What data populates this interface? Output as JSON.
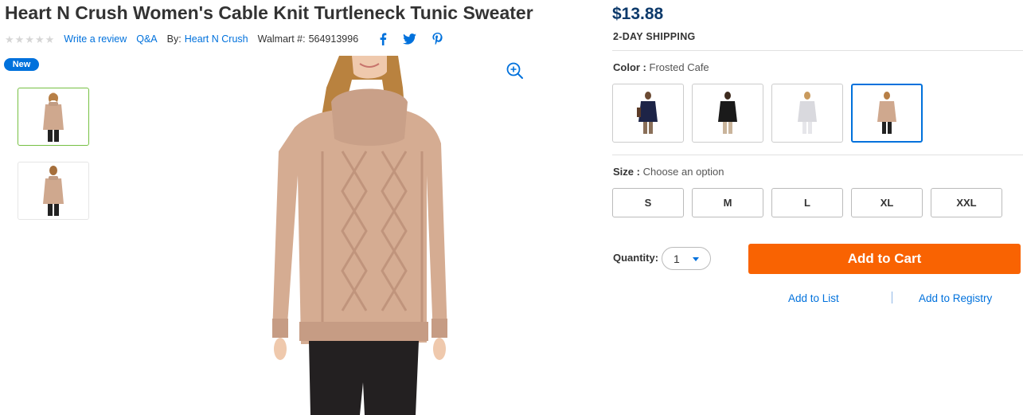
{
  "product": {
    "title": "Heart N Crush Women's Cable Knit Turtleneck Tunic Sweater",
    "rating_stars": 0,
    "write_review": "Write a review",
    "qa": "Q&A",
    "by_label": "By:",
    "brand": "Heart N Crush",
    "walmart_label": "Walmart #:",
    "walmart_number": "564913996",
    "badge": "New"
  },
  "social": {
    "facebook_icon": "facebook-icon",
    "twitter_icon": "twitter-icon",
    "pinterest_icon": "pinterest-icon"
  },
  "pricing": {
    "price": "$13.88",
    "shipping": "2-DAY SHIPPING"
  },
  "color": {
    "label": "Color :",
    "value": "Frosted Cafe",
    "options": [
      "navy",
      "black",
      "light-gray",
      "frosted-cafe"
    ],
    "selected_index": 3
  },
  "size": {
    "label": "Size :",
    "value": "Choose an option",
    "options": [
      "S",
      "M",
      "L",
      "XL",
      "XXL"
    ]
  },
  "quantity": {
    "label": "Quantity:",
    "value": "1"
  },
  "actions": {
    "add_to_cart": "Add to Cart",
    "add_to_list": "Add to List",
    "add_to_registry": "Add to Registry"
  },
  "colors": {
    "link": "#0071dc",
    "price": "#0d3a6b",
    "cart_button": "#f96302",
    "selected_thumb": "#76c043"
  }
}
